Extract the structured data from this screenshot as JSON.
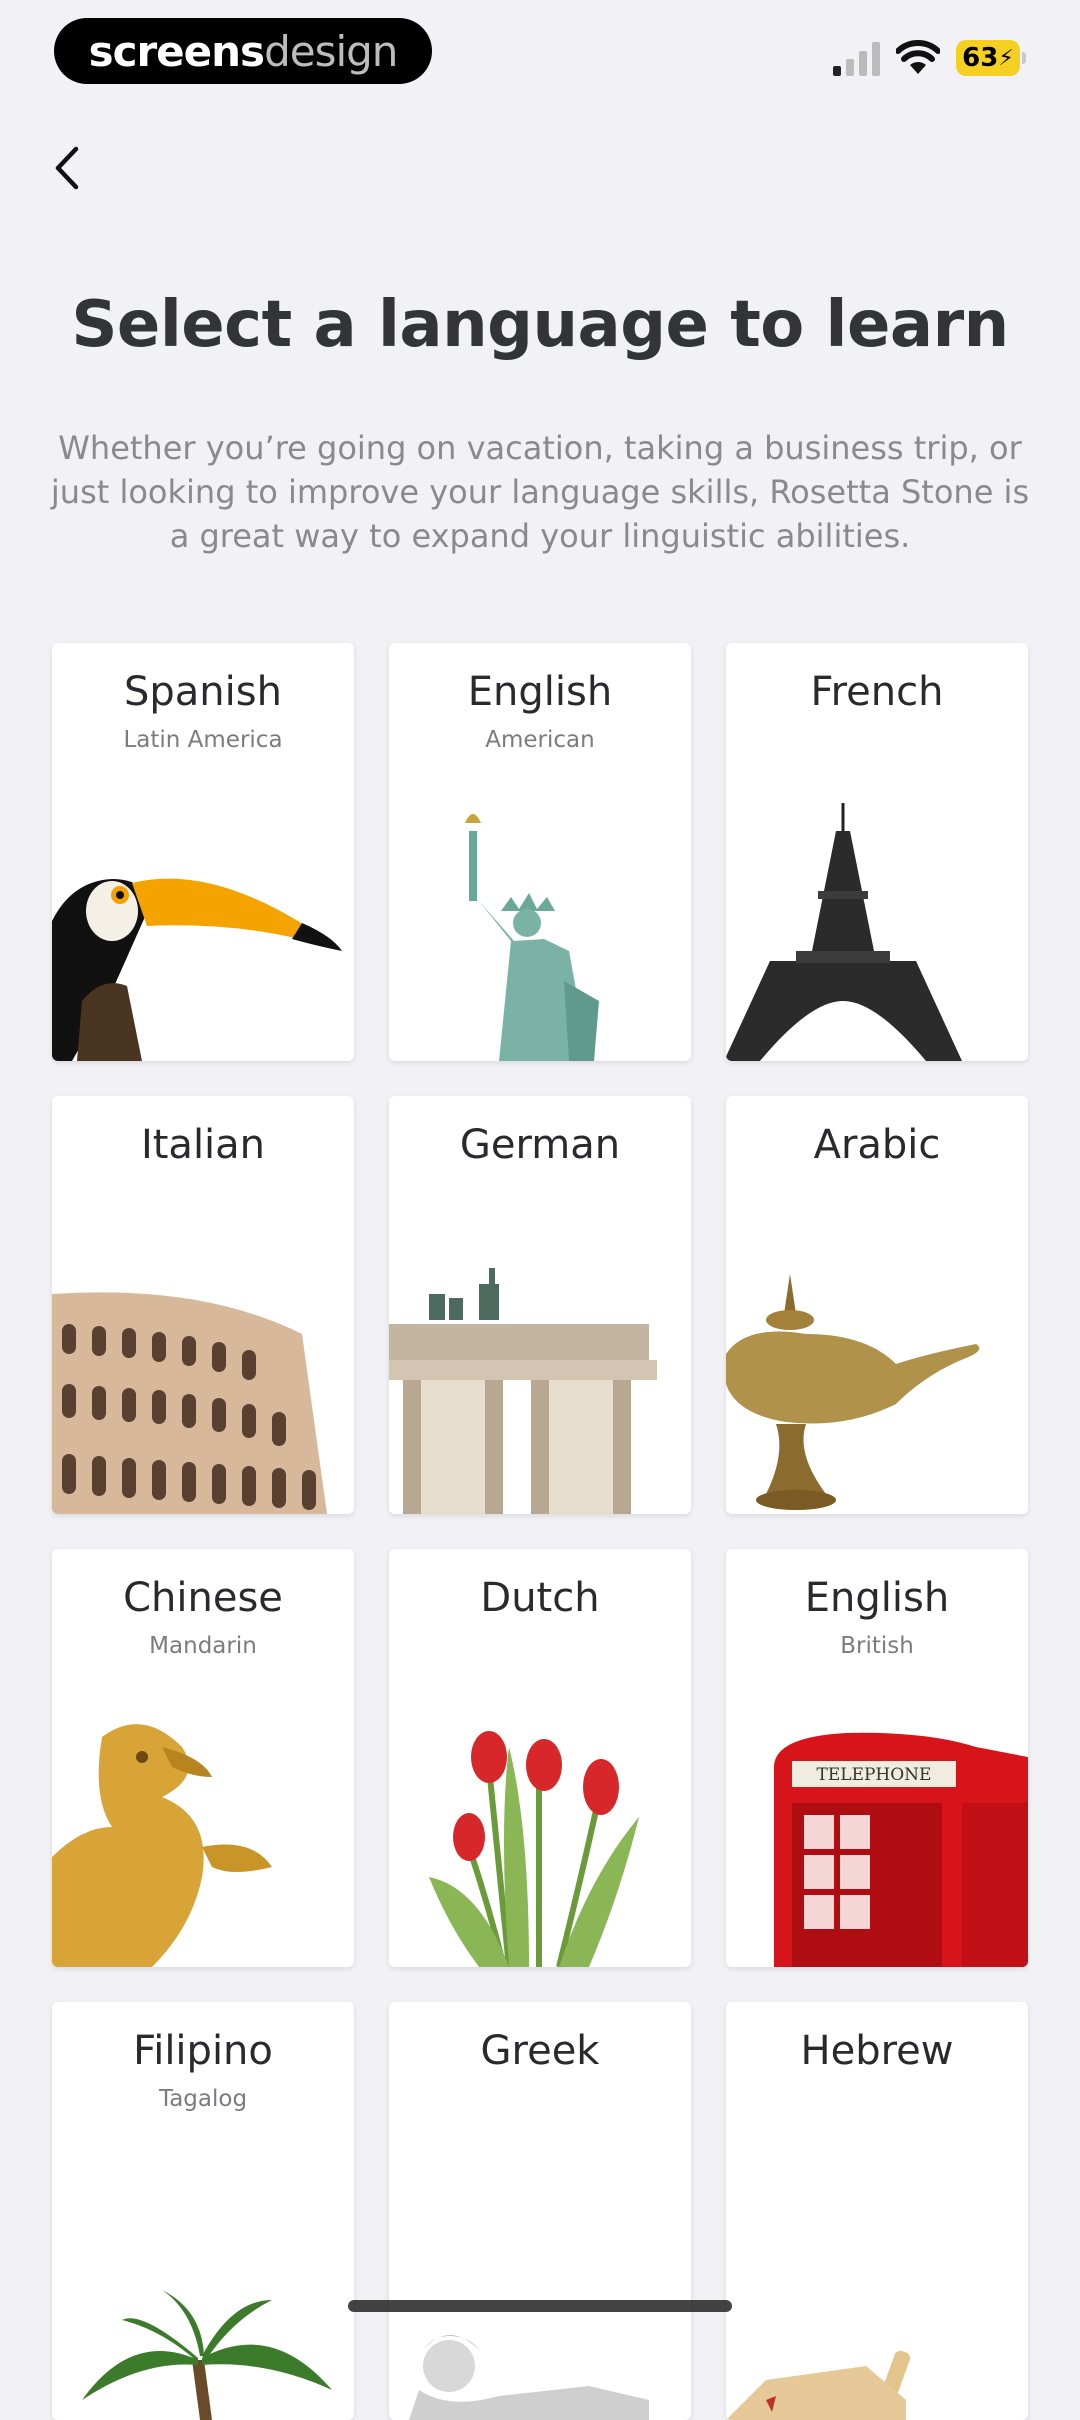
{
  "status_bar": {
    "brand_part1": "screens",
    "brand_part2": "design",
    "battery_level": "63"
  },
  "header": {
    "title": "Select a language to learn",
    "subtitle": "Whether you’re going on vacation, taking a business trip, or just looking to improve your language skills, Rosetta Stone is a great way to expand your linguistic abilities."
  },
  "languages": [
    {
      "name": "Spanish",
      "variant": "Latin America",
      "icon": "toucan-icon"
    },
    {
      "name": "English",
      "variant": "American",
      "icon": "statue-of-liberty-icon"
    },
    {
      "name": "French",
      "variant": "",
      "icon": "eiffel-tower-icon"
    },
    {
      "name": "Italian",
      "variant": "",
      "icon": "colosseum-icon"
    },
    {
      "name": "German",
      "variant": "",
      "icon": "brandenburg-gate-icon"
    },
    {
      "name": "Arabic",
      "variant": "",
      "icon": "oil-lamp-icon"
    },
    {
      "name": "Chinese",
      "variant": "Mandarin",
      "icon": "dragon-icon"
    },
    {
      "name": "Dutch",
      "variant": "",
      "icon": "tulips-icon"
    },
    {
      "name": "English",
      "variant": "British",
      "icon": "phone-booth-icon",
      "booth_sign": "TELEPHONE"
    },
    {
      "name": "Filipino",
      "variant": "Tagalog",
      "icon": "palm-tree-icon"
    },
    {
      "name": "Greek",
      "variant": "",
      "icon": "greek-statue-icon"
    },
    {
      "name": "Hebrew",
      "variant": "",
      "icon": "dreidel-icon"
    }
  ],
  "colors": {
    "background": "#f2f2f6",
    "card": "#ffffff",
    "title": "#333438",
    "subtitle": "#8a8a8e",
    "battery": "#f5d020"
  }
}
